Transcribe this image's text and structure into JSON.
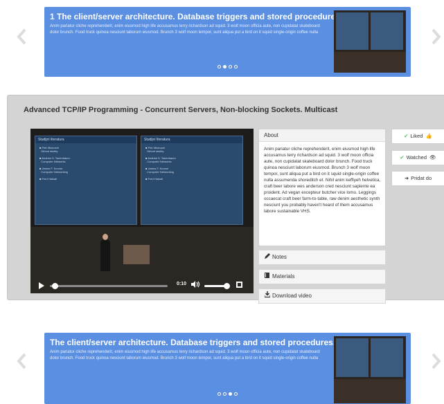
{
  "carousel_top": {
    "title": "1 The client/server architecture. Database triggers and stored procedures.",
    "description": "Anim pariatur cliche reprehenderit, enim eiusmod high life accusamus terry richardson ad squid. 3 wolf moon officia aute, non cupidatat skateboard dolor brunch. Food truck quinoa nesciunt laborum eiusmod. Brunch 3 wolf moon tempor, sunt aliqua put a bird on it squid single-origin coffee nulla",
    "active_dot": 2
  },
  "panel": {
    "title": "Advanced TCP/IP Programming - Concurrent Servers, Non-blocking Sockets. Multicast",
    "video": {
      "time": "0:10",
      "progress_fraction": 0.04,
      "volume_fraction": 1.0,
      "slide_header": "Studijní literatura"
    },
    "about": {
      "heading": "About",
      "text": "Anim pariatur cliche reprehenderit, enim eiusmod high life accusamus terry richardson ad squid. 3 wolf moon officia aute, non cupidatat skateboard dolor brunch. Food truck quinoa nesciunt laborum eiusmod. Brunch 3 wolf moon tempor, sunt aliqua put a bird on it squid single-origin coffee nulla assumenda shoreditch et. Nihil anim keffiyeh helvetica, craft beer labore wes anderson cred nesciunt sapiente ea proident. Ad vegan excepteur butcher vice lomo. Leggings occaecat craft beer farm-to-table, raw denim aesthetic synth nesciunt you probably haven't heard of them accusamus labore sustainable VHS."
    },
    "sections": {
      "notes": "Notes",
      "materials": "Materials",
      "download": "Download video"
    },
    "actions": {
      "liked": "Liked",
      "watched": "Watched",
      "add": "Pridat do"
    }
  },
  "carousel_bottom": {
    "title": "The client/server architecture. Database triggers and stored procedures.",
    "description": "Anim pariatur cliche reprehenderit, enim eiusmod high life accusamus terry richardson ad squid. 3 wolf moon officia aute, non cupidatat skateboard dolor brunch. Food truck quinoa nesciunt laborum eiusmod. Brunch 3 wolf moon tempor, sunt aliqua put a bird on it squid single-origin coffee nulla",
    "active_dot": 3
  },
  "colors": {
    "carousel_bg": "#5a8fe2",
    "panel_bg": "#d4d4d4",
    "success": "#5cb85c"
  }
}
